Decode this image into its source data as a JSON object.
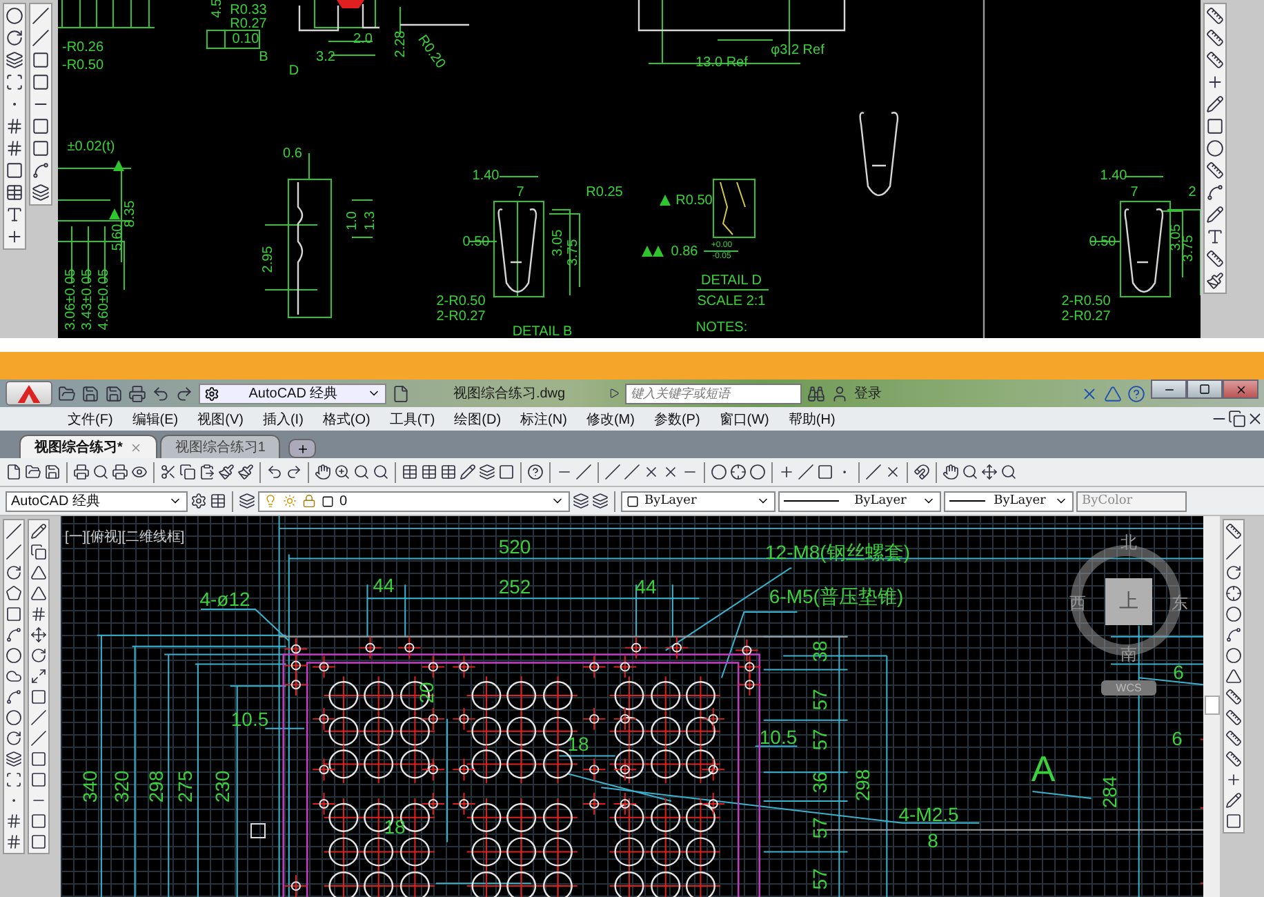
{
  "top_view": {
    "labels": [
      "4.5",
      "R0.33",
      "R0.27",
      "0.10",
      "B",
      "D",
      "3.2",
      "2.0",
      "2.28",
      "R0.20",
      "-R0.26",
      "-R0.50",
      "±0.02(t)",
      "8.35",
      "5.60",
      "3.06±0.05",
      "3.43±0.05",
      "4.60±0.05",
      "0.6",
      "1.0",
      "1.3",
      "2.95",
      "1.40",
      "7",
      "R0.25",
      "0.50",
      "3.05",
      "3.75",
      "2-R0.50",
      "2-R0.27",
      "DETAIL B",
      "13.0 Ref",
      "φ3.2 Ref",
      "R0.50",
      "0.86",
      "+0.00",
      "-0.05",
      "DETAIL D",
      "SCALE 2:1",
      "NOTES:",
      "1.40",
      "7",
      "0.50",
      "3.05",
      "3.75",
      "2-R0.50",
      "2-R0.27",
      "2"
    ]
  },
  "window": {
    "title": "视图综合练习.dwg",
    "workspace": "AutoCAD 经典",
    "search": {
      "placeholder": "键入关键字或短语"
    },
    "login": "登录"
  },
  "menu": [
    "文件(F)",
    "编辑(E)",
    "视图(V)",
    "插入(I)",
    "格式(O)",
    "工具(T)",
    "绘图(D)",
    "标注(N)",
    "修改(M)",
    "参数(P)",
    "窗口(W)",
    "帮助(H)"
  ],
  "tabs": [
    {
      "label": "视图综合练习*",
      "selected": true
    },
    {
      "label": "视图综合练习1",
      "selected": false
    }
  ],
  "properties": {
    "workspace": "AutoCAD 经典",
    "layer": "0",
    "color_setting": "ByLayer",
    "linetype": "ByLayer",
    "lineweight": "ByLayer",
    "plot_style": {
      "value": "ByColor",
      "disabled": true
    }
  },
  "viewport": {
    "label": "[一][俯视][二维线框]",
    "labels": [
      "520",
      "44",
      "252",
      "44",
      "4-ø12",
      "12-M8(钢丝螺套)",
      "6-M5(普压垫锥)",
      "10.5",
      "340",
      "320",
      "298",
      "275",
      "230",
      "20",
      "18",
      "18",
      "38",
      "57",
      "10.5",
      "57",
      "36",
      "298",
      "57",
      "4-M2.5",
      "8",
      "57",
      "A",
      "284",
      "6",
      "6"
    ],
    "viewcube": {
      "north": "北",
      "south": "南",
      "west": "西",
      "east": "东",
      "face": "上",
      "ucs": "WCS"
    }
  }
}
